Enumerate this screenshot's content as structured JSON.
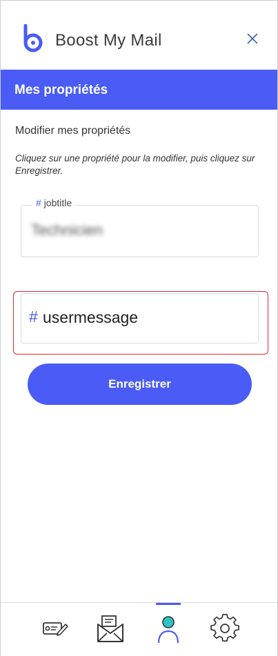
{
  "app": {
    "title": "Boost My Mail",
    "accent_color": "#4a5cf5",
    "logo_color": "#4a5cf5"
  },
  "header": {
    "close_icon": "close-icon"
  },
  "section": {
    "title": "Mes propriétés"
  },
  "content": {
    "subtitle": "Modifier mes propriétés",
    "instruction": "Cliquez sur une propriété pour la modifier, puis cliquez sur Enregistrer."
  },
  "fields": [
    {
      "hash": "#",
      "name": "jobtitle",
      "value": "Technicien"
    },
    {
      "hash": "#",
      "name": "usermessage",
      "value": ""
    }
  ],
  "highlight_color": "#e0262a",
  "save_button": {
    "label": "Enregistrer"
  },
  "bottom_nav": {
    "items": [
      {
        "icon": "signature-card-icon",
        "active": false
      },
      {
        "icon": "mail-icon",
        "active": false
      },
      {
        "icon": "user-icon",
        "active": true
      },
      {
        "icon": "gear-icon",
        "active": false
      }
    ]
  }
}
